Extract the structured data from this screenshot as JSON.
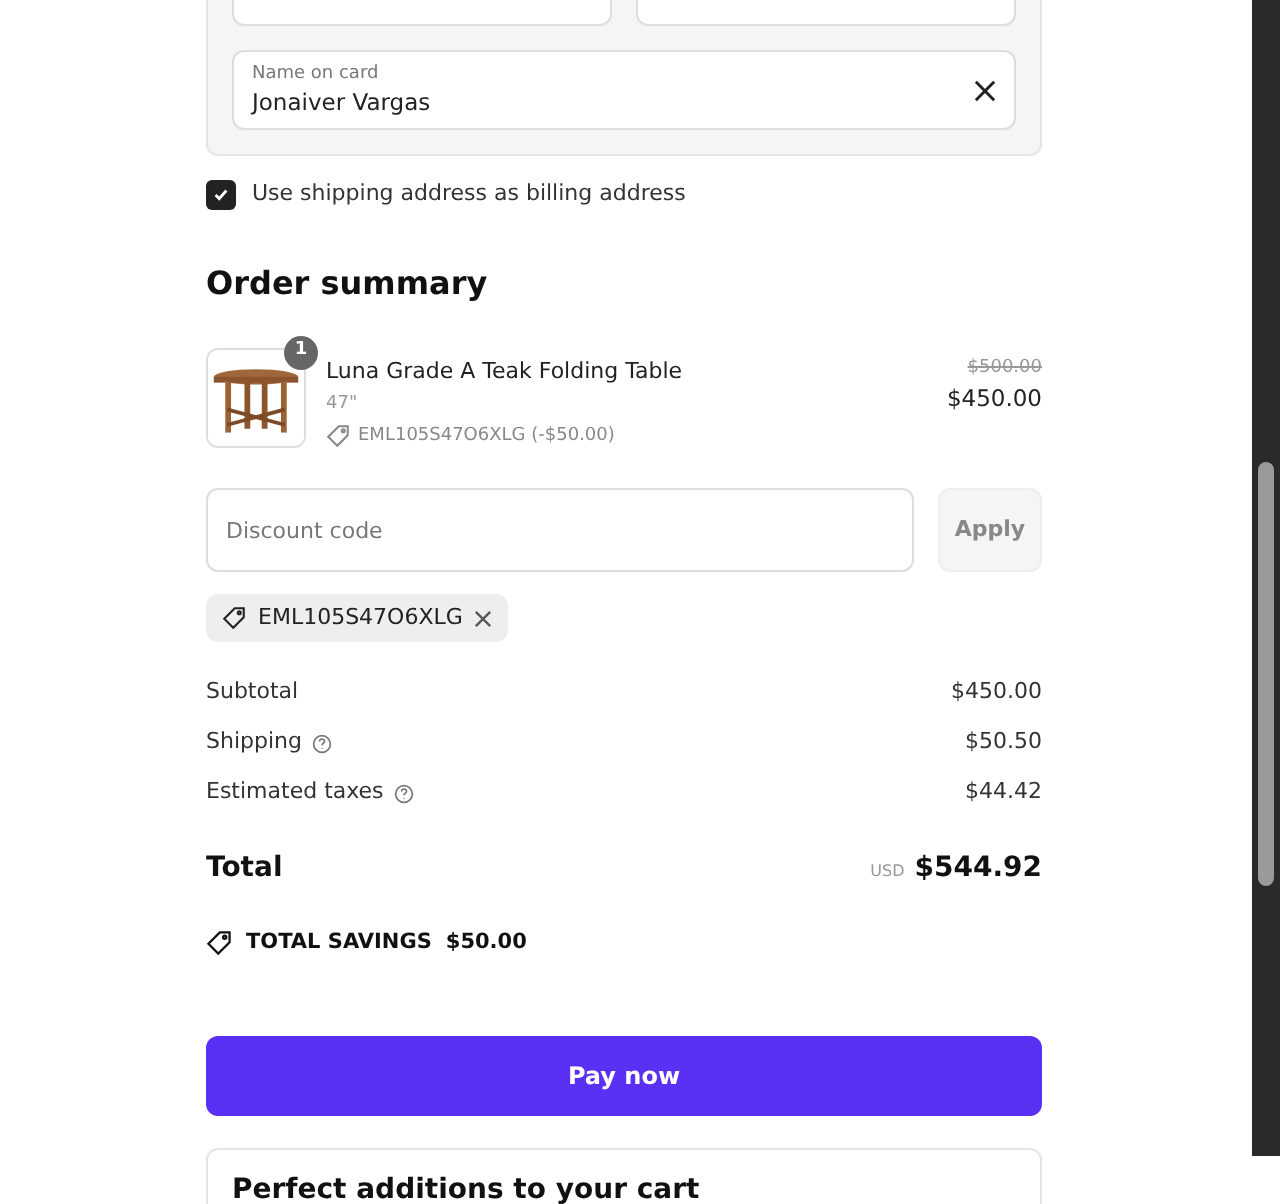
{
  "payment_card": {
    "name_field": {
      "label": "Name on card",
      "value": "Jonaiver Vargas"
    }
  },
  "billing_checkbox": {
    "label": "Use shipping address as billing address",
    "checked": true
  },
  "order_summary": {
    "title": "Order summary",
    "items": [
      {
        "name": "Luna Grade A Teak Folding Table",
        "quantity": "1",
        "variant": "47\"",
        "discount": "EML105S47O6XLG (-$50.00)",
        "original_price": "$500.00",
        "price": "$450.00"
      }
    ],
    "discount_field": {
      "placeholder": "Discount code"
    },
    "apply_button": "Apply",
    "applied_codes": [
      "EML105S47O6XLG"
    ],
    "lines": [
      {
        "label": "Subtotal",
        "value": "$450.00",
        "info": false
      },
      {
        "label": "Shipping",
        "value": "$50.50",
        "info": true
      },
      {
        "label": "Estimated taxes",
        "value": "$44.42",
        "info": true
      }
    ],
    "total": {
      "label": "Total",
      "currency": "USD",
      "value": "$544.92"
    },
    "savings": {
      "label": "TOTAL SAVINGS",
      "value": "$50.00"
    }
  },
  "pay_button": "Pay now",
  "additions": {
    "title": "Perfect additions to your cart"
  }
}
